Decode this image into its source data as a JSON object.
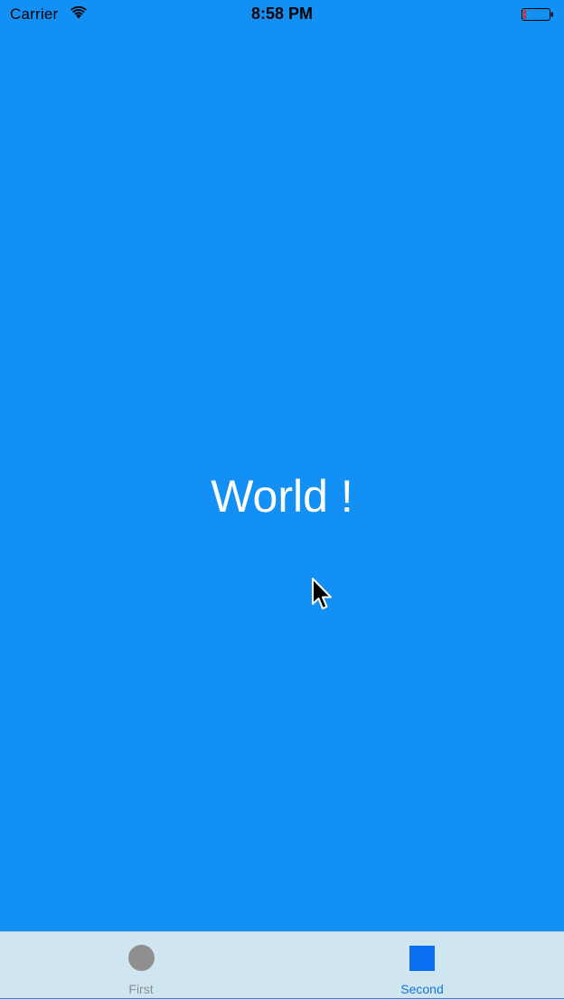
{
  "status_bar": {
    "carrier": "Carrier",
    "time": "8:58 PM",
    "wifi_icon": "wifi-icon",
    "battery_icon": "battery-icon",
    "battery_level": 0.1
  },
  "content": {
    "label": "World !",
    "background_color": "#1290f5",
    "text_color": "#ffffff"
  },
  "tab_bar": {
    "selected_index": 1,
    "tabs": [
      {
        "label": "First",
        "icon": "circle-icon",
        "color": "#8f8f8f"
      },
      {
        "label": "Second",
        "icon": "square-icon",
        "color": "#1673e6"
      }
    ]
  },
  "cursor": {
    "icon": "mouse-pointer-icon"
  }
}
